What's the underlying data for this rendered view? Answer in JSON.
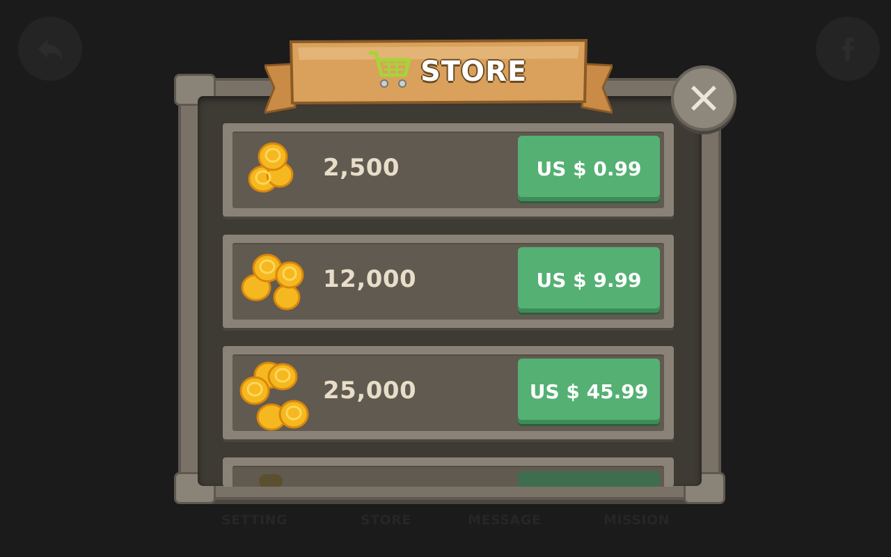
{
  "store": {
    "title": "STORE",
    "close_icon": "close-icon",
    "cart_icon": "shopping-cart-icon"
  },
  "background": {
    "back_icon": "back-arrow-icon",
    "facebook_icon": "facebook-icon",
    "nav": [
      {
        "label": "SETTING"
      },
      {
        "label": "STORE"
      },
      {
        "label": "MESSAGE"
      },
      {
        "label": "MISSION"
      }
    ]
  },
  "items": [
    {
      "amount": "2,500",
      "price": "US $ 0.99",
      "icon": "small-coin-stack-icon"
    },
    {
      "amount": "12,000",
      "price": "US $ 9.99",
      "icon": "medium-coin-stack-icon"
    },
    {
      "amount": "25,000",
      "price": "US $ 45.99",
      "icon": "large-coin-stack-icon"
    }
  ],
  "colors": {
    "buy_button": "#55b074",
    "panel": "#7a7267",
    "banner": "#d9a15b",
    "coin": "#f5b820"
  }
}
